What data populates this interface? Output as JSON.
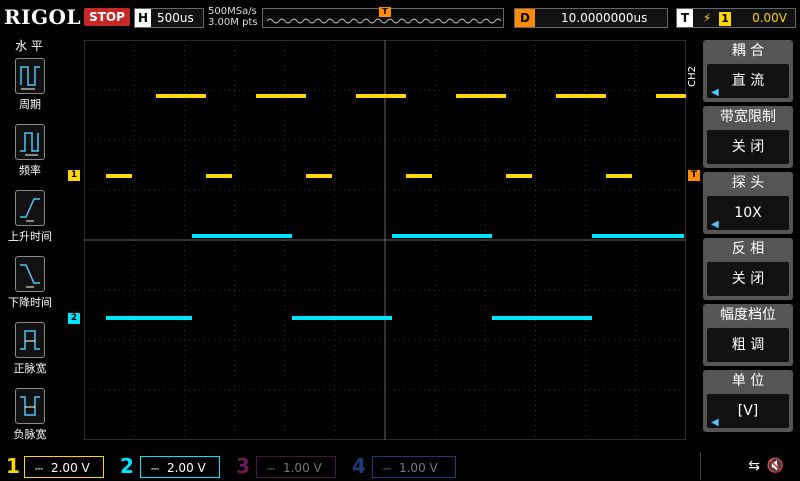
{
  "top": {
    "brand": "RIGOL",
    "run_state": "STOP",
    "h_label": "H",
    "timebase": "500us",
    "sample_rate": "500MSa/s",
    "mem_depth": "3.00M pts",
    "trigger_marker": "T",
    "delay_label": "D",
    "delay_value": "10.0000000us",
    "trigger_label": "T",
    "trigger_edge": "rising-edge-icon",
    "trigger_source": "1",
    "trigger_level": "0.00V"
  },
  "left_menu": {
    "title": "水 平",
    "items": [
      {
        "label": "周期",
        "icon": "period-icon"
      },
      {
        "label": "频率",
        "icon": "frequency-icon"
      },
      {
        "label": "上升时间",
        "icon": "rise-time-icon"
      },
      {
        "label": "下降时间",
        "icon": "fall-time-icon"
      },
      {
        "label": "正脉宽",
        "icon": "positive-width-icon"
      },
      {
        "label": "负脉宽",
        "icon": "negative-width-icon"
      }
    ]
  },
  "right_menu": {
    "channel_tag": "CH2",
    "groups": [
      {
        "title": "耦 合",
        "value": "直 流",
        "has_arrow": true
      },
      {
        "title": "带宽限制",
        "value": "关 闭",
        "has_arrow": false
      },
      {
        "title": "探 头",
        "value": "10X",
        "has_arrow": true
      },
      {
        "title": "反 相",
        "value": "关 闭",
        "has_arrow": false
      },
      {
        "title": "幅度档位",
        "value": "粗 调",
        "has_arrow": false
      },
      {
        "title": "单 位",
        "value": "[V]",
        "has_arrow": true
      }
    ]
  },
  "markers": {
    "ch1_marker": "1",
    "ch2_marker": "2",
    "trigger_level_marker": "T"
  },
  "bottom": {
    "channels": [
      {
        "num": "1",
        "scale": "2.00 V",
        "color": "#ffd600",
        "active": true
      },
      {
        "num": "2",
        "scale": "2.00 V",
        "color": "#00e5ff",
        "active": true
      },
      {
        "num": "3",
        "scale": "1.00 V",
        "color": "#e040fb",
        "active": false
      },
      {
        "num": "4",
        "scale": "1.00 V",
        "color": "#2979ff",
        "active": false
      }
    ],
    "coupling_symbol": "⎓"
  },
  "colors": {
    "ch1": "#ffd600",
    "ch2": "#00e5ff",
    "trigger": "#ff8c00",
    "stop": "#c62828"
  }
}
